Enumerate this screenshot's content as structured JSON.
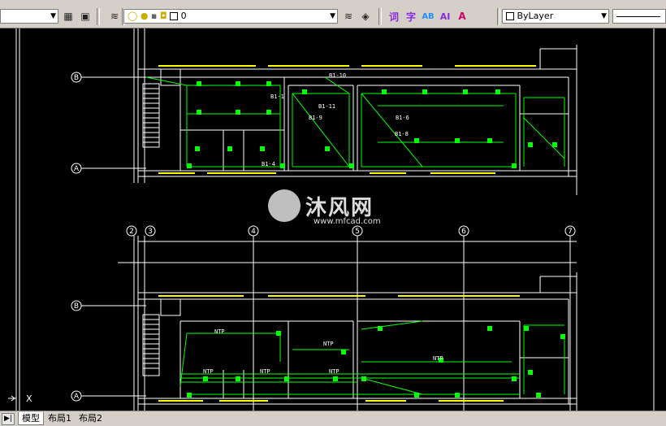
{
  "toolbar": {
    "layer_name": "0",
    "bylayer_label": "ByLayer",
    "text_buttons": [
      "词",
      "字",
      "AB",
      "AI",
      "A"
    ]
  },
  "tabs": [
    {
      "label": "模型",
      "active": true
    },
    {
      "label": "布局1",
      "active": false
    },
    {
      "label": "布局2",
      "active": false
    }
  ],
  "watermark": {
    "brand": "沐风网",
    "url": "www.mfcad.com"
  },
  "drawing": {
    "top_plan": {
      "axis_labels": [
        "B",
        "A"
      ],
      "circuit_labels": [
        "B1-10",
        "B1-1",
        "B1-11",
        "B1-9",
        "B1-6",
        "B1-8",
        "B1-4"
      ]
    },
    "bottom_plan": {
      "column_labels": [
        "2",
        "3",
        "4",
        "5",
        "6",
        "7"
      ],
      "axis_labels": [
        "B",
        "A"
      ],
      "circuit_labels": [
        "NTP",
        "NTP",
        "NTP",
        "NTP",
        "NTP",
        "NTP"
      ]
    },
    "ucs_label": "X"
  },
  "colors": {
    "background": "#000000",
    "wall": "#ffffff",
    "wiring": "#00ff00",
    "fixtures": "#ffff00",
    "dim": "#808080"
  }
}
